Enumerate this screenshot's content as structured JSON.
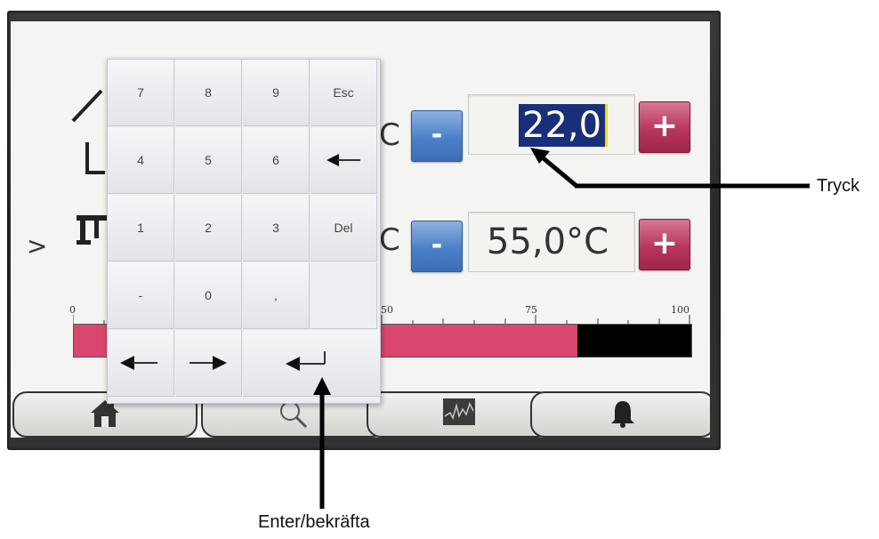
{
  "temperature_rows": [
    {
      "value_text": "22,0",
      "unit": "C"
    },
    {
      "value_text": "55,0°C",
      "unit": "C"
    }
  ],
  "buttons": {
    "minus_label": "-",
    "plus_label": "+"
  },
  "nav": {
    "chevron": ">"
  },
  "scale": {
    "ticks": [
      "0",
      "50",
      "75",
      "100"
    ],
    "fill_fraction": 0.815
  },
  "keypad": {
    "keys": [
      "7",
      "8",
      "9",
      "Esc",
      "4",
      "5",
      "6",
      "backspace",
      "1",
      "2",
      "3",
      "Del",
      "-",
      "0",
      ",",
      ""
    ],
    "bottom_row": [
      "left-arrow",
      "right-arrow",
      "enter"
    ]
  },
  "bottom_nav": [
    "home-icon",
    "search-icon",
    "trend-icon",
    "bell-icon"
  ],
  "annotations": {
    "tryck": "Tryck",
    "enter": "Enter/bekräfta"
  },
  "colors": {
    "minus_blue": "#4a7fc7",
    "plus_red": "#b8365d",
    "bar_fill": "#d9476f",
    "selection": "#1a2f7a"
  }
}
